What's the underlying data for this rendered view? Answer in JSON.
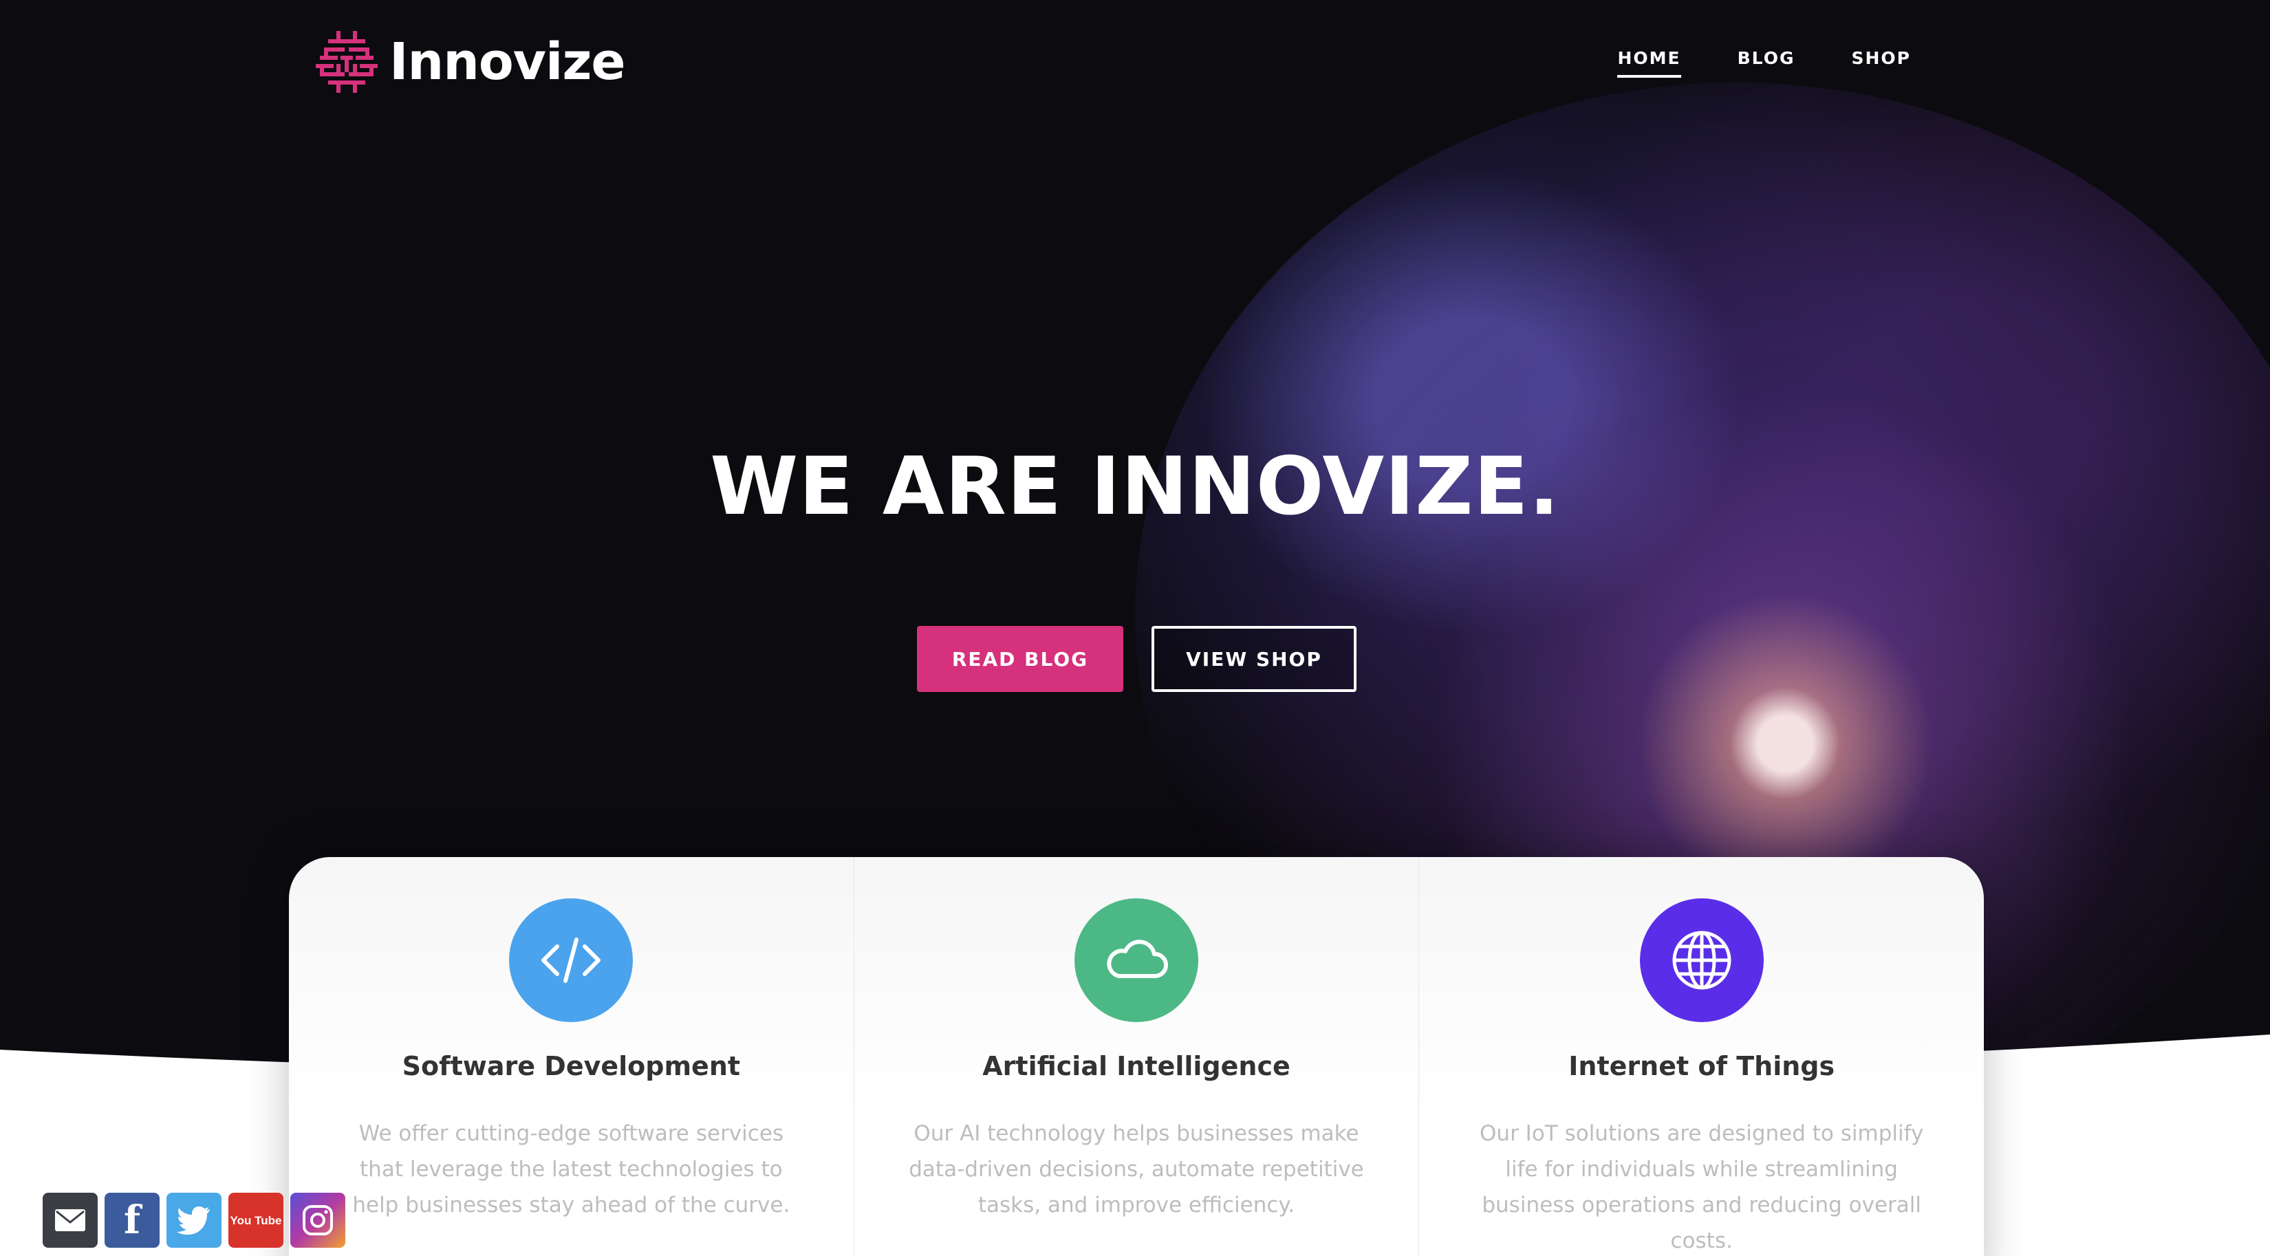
{
  "brand": {
    "name": "Innovize",
    "accent": "#d6317c"
  },
  "nav": {
    "items": [
      {
        "label": "HOME",
        "active": true
      },
      {
        "label": "BLOG",
        "active": false
      },
      {
        "label": "SHOP",
        "active": false
      }
    ]
  },
  "hero": {
    "title": "WE ARE INNOVIZE.",
    "primary_button": "READ BLOG",
    "secondary_button": "VIEW SHOP"
  },
  "services": [
    {
      "title": "Software Development",
      "description": "We offer cutting-edge software services that leverage the latest technologies to help businesses stay ahead of the curve.",
      "icon": "code-icon",
      "color": "#4aa3ec"
    },
    {
      "title": "Artificial Intelligence",
      "description": "Our AI technology helps businesses make data-driven decisions, automate repetitive tasks, and improve efficiency.",
      "icon": "cloud-icon",
      "color": "#4cb886"
    },
    {
      "title": "Internet of Things",
      "description": "Our IoT solutions are designed to simplify life for individuals while streamlining business operations and reducing overall costs.",
      "icon": "globe-icon",
      "color": "#5a2ee8"
    }
  ],
  "social": [
    {
      "icon": "email-icon",
      "color": "#3b3f45"
    },
    {
      "icon": "facebook-icon",
      "label": "f",
      "color": "#3b5b9c"
    },
    {
      "icon": "twitter-icon",
      "color": "#49a8e8"
    },
    {
      "icon": "youtube-icon",
      "label": "You Tube",
      "color": "#d8332b"
    },
    {
      "icon": "instagram-icon",
      "color": "#b23ba3"
    }
  ]
}
